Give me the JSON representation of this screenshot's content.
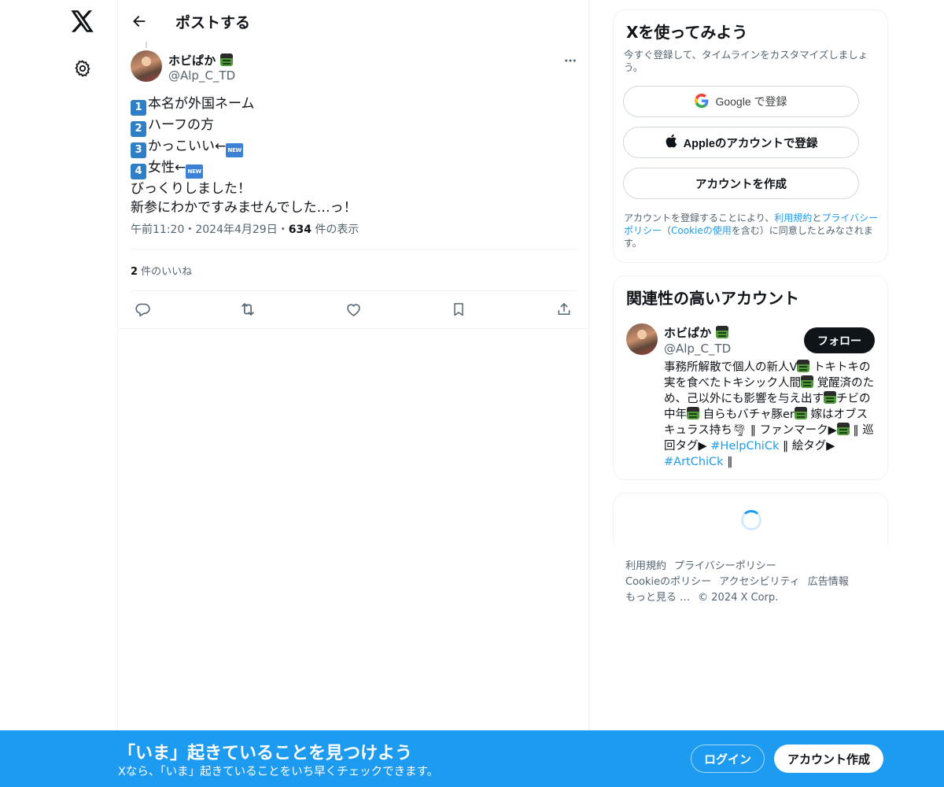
{
  "nav": {
    "logo_icon": "x-logo-icon",
    "settings_icon": "gear-icon"
  },
  "header": {
    "title": "ポストする",
    "back_icon": "arrow-left-icon"
  },
  "post": {
    "author_name": "ホビぱか",
    "author_handle": "@Alp_C_TD",
    "lines": [
      {
        "key": "1",
        "text": "本名が外国ネーム",
        "new": ""
      },
      {
        "key": "2",
        "text": "ハーフの方",
        "new": ""
      },
      {
        "key": "3",
        "text": "かっこいい←",
        "new": "NEW"
      },
      {
        "key": "4",
        "text": "女性←",
        "new": "NEW"
      },
      {
        "key": "",
        "text": "びっくりしました！",
        "new": ""
      },
      {
        "key": "",
        "text": "新参にわかですみませんでした…っ！",
        "new": ""
      }
    ],
    "time": "午前11:20",
    "sep": "・",
    "date": "2024年4月29日",
    "views_count": "634",
    "views_label": " 件の表示",
    "likes_count": "2",
    "likes_label": " 件のいいね"
  },
  "signup_card": {
    "title": "Xを使ってみよう",
    "subtitle": "今すぐ登録して、タイムラインをカスタマイズしましょう。",
    "google_label": "Google で登録",
    "apple_label": "Appleのアカウントで登録",
    "create_label": "アカウントを作成",
    "legal_1": "アカウントを登録することにより、",
    "legal_terms": "利用規約",
    "legal_2": "と",
    "legal_privacy": "プライバシーポリシー",
    "legal_3": "（",
    "legal_cookie": "Cookieの使用",
    "legal_4": "を含む）に同意したとみなされます。"
  },
  "related": {
    "title": "関連性の高いアカウント",
    "name": "ホビぱか",
    "handle": "@Alp_C_TD",
    "follow_label": "フォロー",
    "bio_1": "事務所解散で個人の新人V",
    "bio_2": " トキトキの実を食べたトキシック人間",
    "bio_3": " 覚醒済のため、己以外にも影響を与え出す",
    "bio_4": "チビの中年",
    "bio_5": " 自らもバチャ豚er",
    "bio_6": " 嫁はオブスキュラス持ち",
    "bio_7": " ‖ ファンマーク▶",
    "bio_8": " ‖ 巡回タグ▶ ",
    "tag_1": "#HelpChiCk",
    "bio_9": " ‖ 絵タグ▶ ",
    "tag_2": "#ArtChiCk",
    "bio_10": " ‖"
  },
  "footer": {
    "terms": "利用規約",
    "privacy": "プライバシーポリシー",
    "cookie": "Cookieのポリシー",
    "accessibility": "アクセシビリティ",
    "ads": "広告情報",
    "more": "もっと見る …",
    "copyright": "© 2024 X Corp."
  },
  "banner": {
    "title": "「いま」起きていることを見つけよう",
    "subtitle": "Xなら、「いま」起きていることをいち早くチェックできます。",
    "login_label": "ログイン",
    "signup_label": "アカウント作成"
  },
  "colors": {
    "accent": "#1d9bf0",
    "text": "#0f1419",
    "muted": "#536471",
    "border": "#eff3f4"
  }
}
